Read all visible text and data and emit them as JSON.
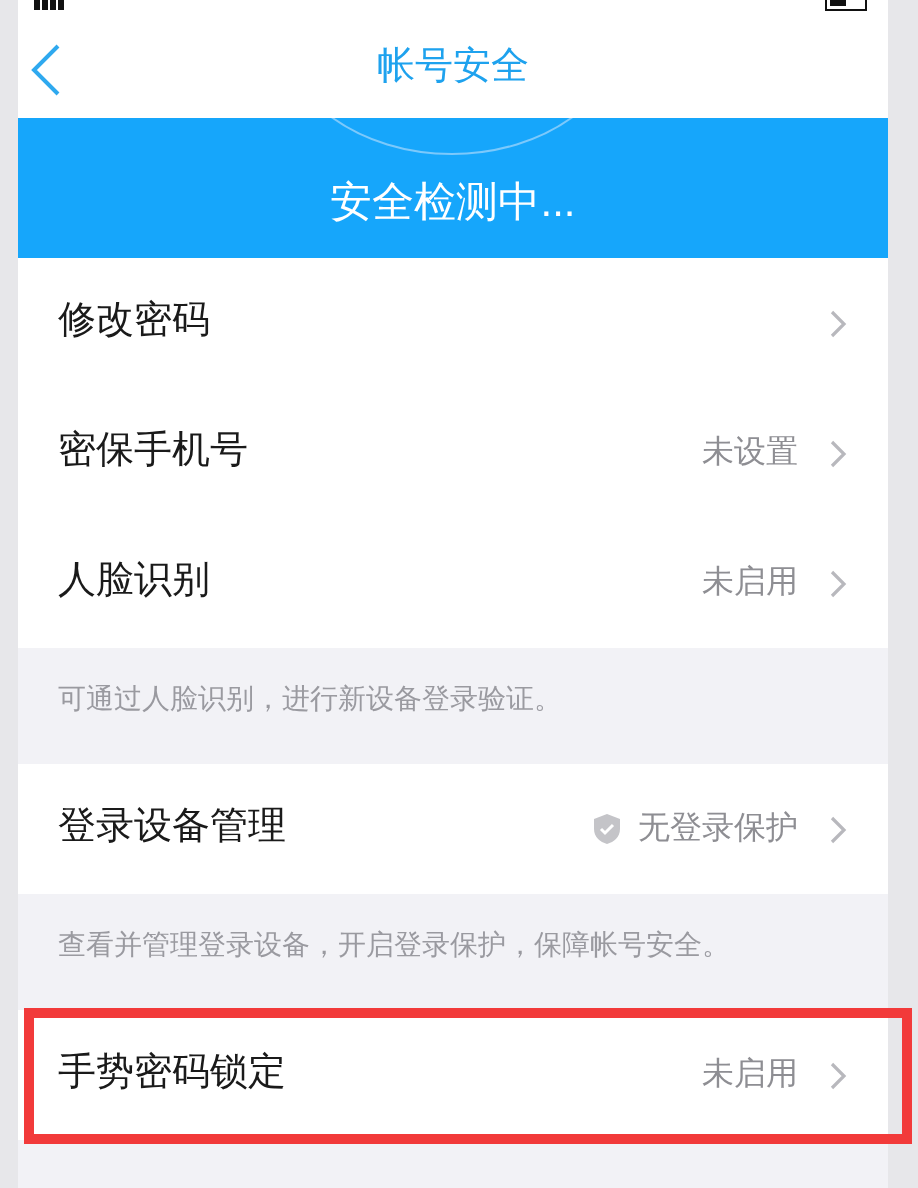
{
  "header": {
    "title": "帐号安全"
  },
  "banner": {
    "text": "安全检测中..."
  },
  "sections": [
    {
      "rows": [
        {
          "kind": "plain",
          "title": "修改密码",
          "highlighted": false
        },
        {
          "kind": "value",
          "title": "密保手机号",
          "value": "未设置",
          "highlighted": false
        },
        {
          "kind": "value",
          "title": "人脸识别",
          "value": "未启用",
          "highlighted": false
        }
      ],
      "note": "可通过人脸识别，进行新设备登录验证。"
    },
    {
      "rows": [
        {
          "kind": "shield",
          "title": "登录设备管理",
          "value": "无登录保护",
          "highlighted": false
        }
      ],
      "note": "查看并管理登录设备，开启登录保护，保障帐号安全。"
    },
    {
      "rows": [
        {
          "kind": "value",
          "title": "手势密码锁定",
          "value": "未启用",
          "highlighted": true
        }
      ]
    }
  ]
}
